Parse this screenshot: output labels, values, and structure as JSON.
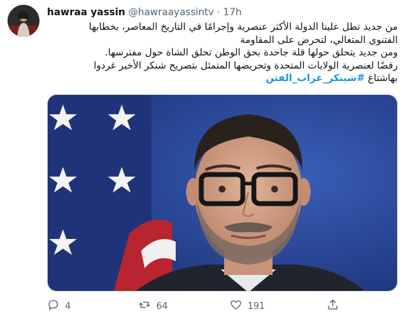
{
  "tweet": {
    "display_name": "hawraa yassin",
    "handle": "@hawraayassintv",
    "separator": "·",
    "time": "17h",
    "lines": [
      "من جديد تطل علينا الدولة الأكثر عنصرية وإجرامًا في التاريخ المعاصر، بخطابها",
      "الفتنوي المتعالي، لتحرض على المقاومة",
      "ومن جديد يتحلق حولها قلة جاحدة بحق الوطن تحلق الشاة حول مفترسها.",
      "رفضًا لعنصرية الولايات المتحدة وتحريضها المتمثل بتصريح شنكر الأخير غردوا",
      "بهاشتاغ"
    ],
    "hashtag": "#شينكر_غراب_الفتن",
    "stats": {
      "replies": "4",
      "retweets": "64",
      "likes": "191"
    }
  },
  "colors": {
    "link": "#1b95e0",
    "muted": "#536471",
    "text": "#0f1419"
  },
  "icons": [
    "reply-icon",
    "retweet-icon",
    "like-icon",
    "share-icon"
  ]
}
